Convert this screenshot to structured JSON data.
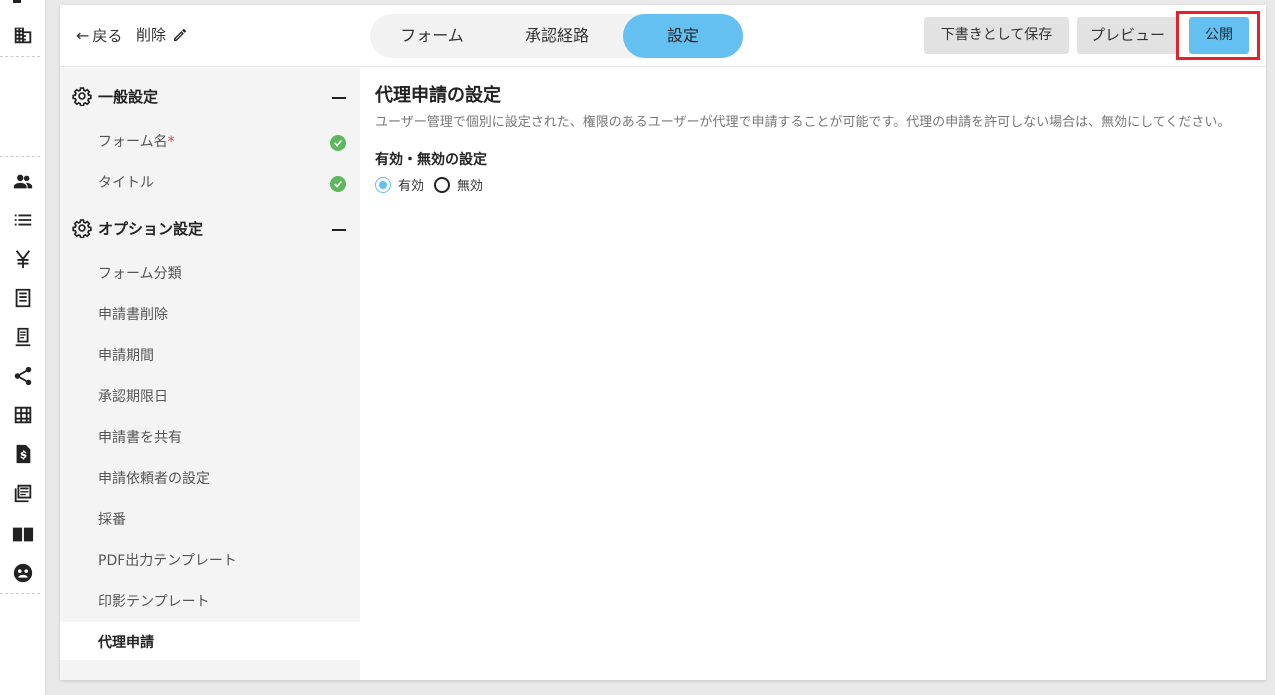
{
  "header": {
    "back_label": "戻る",
    "delete_label": "削除",
    "tabs": [
      {
        "label": "フォーム",
        "active": false
      },
      {
        "label": "承認経路",
        "active": false
      },
      {
        "label": "設定",
        "active": true
      }
    ],
    "save_draft_label": "下書きとして保存",
    "preview_label": "プレビュー",
    "publish_label": "公開"
  },
  "sidebar": {
    "general": {
      "title": "一般設定",
      "items": [
        {
          "label": "フォーム名",
          "required_mark": "*",
          "complete": true
        },
        {
          "label": "タイトル",
          "complete": true
        }
      ]
    },
    "options": {
      "title": "オプション設定",
      "items": [
        {
          "label": "フォーム分類"
        },
        {
          "label": "申請書削除"
        },
        {
          "label": "申請期間"
        },
        {
          "label": "承認期限日"
        },
        {
          "label": "申請書を共有"
        },
        {
          "label": "申請依頼者の設定"
        },
        {
          "label": "採番"
        },
        {
          "label": "PDF出力テンプレート"
        },
        {
          "label": "印影テンプレート"
        },
        {
          "label": "代理申請",
          "active": true
        }
      ]
    }
  },
  "main": {
    "title": "代理申請の設定",
    "description": "ユーザー管理で個別に設定された、権限のあるユーザーが代理で申請することが可能です。代理の申請を許可しない場合は、無効にしてください。",
    "section_label": "有効・無効の設定",
    "options": [
      {
        "label": "有効",
        "selected": true
      },
      {
        "label": "無効",
        "selected": false
      }
    ]
  },
  "rail_icons": [
    "building-icon",
    "users-icon",
    "list-icon",
    "yen-icon",
    "receipt-icon",
    "document-icon",
    "share-icon",
    "grid-icon",
    "invoice-icon",
    "newspaper-icon",
    "book-icon",
    "support-icon"
  ],
  "colors": {
    "accent": "#64c0f0",
    "complete_check": "#5cb85c",
    "required": "#e53935",
    "highlight": "#e8202a"
  }
}
